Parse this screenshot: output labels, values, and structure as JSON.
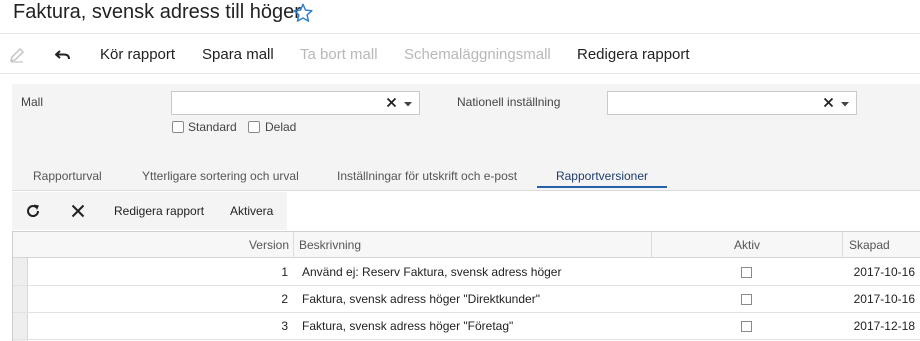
{
  "header": {
    "title": "Faktura, svensk adress till höger",
    "favorite_icon": "star-outline-icon"
  },
  "toolbar": {
    "edit_icon": "pencil-icon",
    "undo_icon": "undo-icon",
    "run_report": "Kör rapport",
    "save_template": "Spara mall",
    "delete_template": "Ta bort mall",
    "schedule_template": "Schemaläggningsmall",
    "edit_report": "Redigera rapport"
  },
  "filters": {
    "template_label": "Mall",
    "template_value": "",
    "standard_label": "Standard",
    "shared_label": "Delad",
    "standard_checked": false,
    "shared_checked": false,
    "national_setting_label": "Nationell inställning",
    "national_setting_value": ""
  },
  "tabs": [
    {
      "label": "Rapporturval",
      "active": false
    },
    {
      "label": "Ytterligare sortering och urval",
      "active": false
    },
    {
      "label": "Inställningar för utskrift och e-post",
      "active": false
    },
    {
      "label": "Rapportversioner",
      "active": true
    }
  ],
  "grid_toolbar": {
    "refresh_icon": "refresh-icon",
    "close_icon": "close-icon",
    "edit_report": "Redigera rapport",
    "activate": "Aktivera"
  },
  "table": {
    "columns": [
      "Version",
      "Beskrivning",
      "Aktiv",
      "Skapad"
    ],
    "rows": [
      {
        "version": "1",
        "description": "Använd ej: Reserv Faktura, svensk adress höger",
        "active": false,
        "created": "2017-10-16"
      },
      {
        "version": "2",
        "description": "Faktura, svensk adress höger \"Direktkunder\"",
        "active": false,
        "created": "2017-10-16"
      },
      {
        "version": "3",
        "description": "Faktura, svensk adress höger \"Företag\"",
        "active": false,
        "created": "2017-12-18"
      }
    ]
  },
  "colors": {
    "accent": "#2563a8",
    "panel": "#f4f4f4",
    "disabled_text": "#b8b8b8"
  }
}
